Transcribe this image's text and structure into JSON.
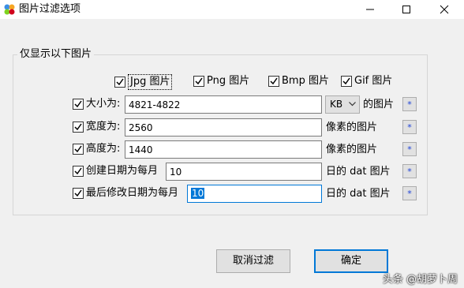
{
  "window": {
    "title": "图片过滤选项"
  },
  "group": {
    "title": "仅显示以下图片"
  },
  "file_types": [
    {
      "label": "Jpg 图片",
      "checked": true,
      "focused": true
    },
    {
      "label": "Png 图片",
      "checked": true
    },
    {
      "label": "Bmp 图片",
      "checked": true
    },
    {
      "label": "Gif 图片",
      "checked": true
    }
  ],
  "filters": {
    "size": {
      "label": "大小为:",
      "checked": true,
      "value": "4821-4822",
      "unit": "KB",
      "suffix": "的图片",
      "star": "*"
    },
    "width": {
      "label": "宽度为:",
      "checked": true,
      "value": "2560",
      "suffix": "像素的图片",
      "star": "*"
    },
    "height": {
      "label": "高度为:",
      "checked": true,
      "value": "1440",
      "suffix": "像素的图片",
      "star": "*"
    },
    "created": {
      "label": "创建日期为每月",
      "checked": true,
      "value": "10",
      "suffix": "日的 dat 图片",
      "star": "*"
    },
    "modified": {
      "label": "最后修改日期为每月",
      "checked": true,
      "value": "10",
      "suffix": "日的 dat 图片",
      "star": "*"
    }
  },
  "buttons": {
    "cancel": "取消过滤",
    "ok": "确定"
  },
  "watermark": "头条 @胡萝卜周",
  "colors": {
    "accent": "#0078d7",
    "star": "#1a3fd6",
    "dialog_bg": "#f0f0f0"
  }
}
